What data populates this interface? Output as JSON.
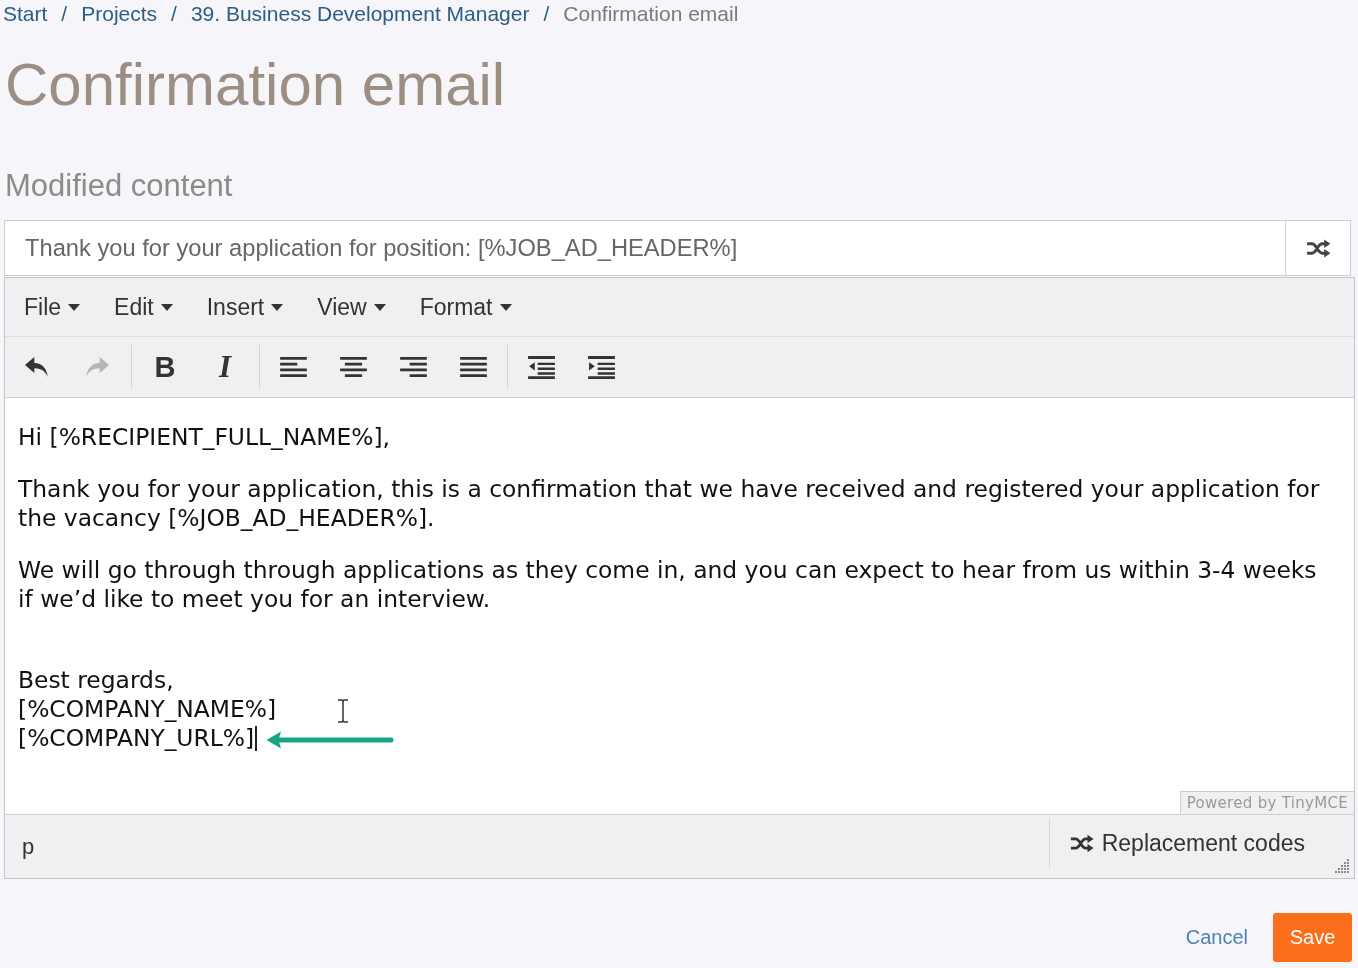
{
  "breadcrumb": [
    {
      "kind": "link",
      "label": "Start"
    },
    {
      "kind": "separator",
      "label": "/"
    },
    {
      "kind": "link",
      "label": "Projects"
    },
    {
      "kind": "separator",
      "label": "/"
    },
    {
      "kind": "link",
      "label": "39. Business Development Manager"
    },
    {
      "kind": "separator",
      "label": "/"
    },
    {
      "kind": "current",
      "label": "Confirmation email"
    }
  ],
  "page_title": "Confirmation email",
  "section_heading": "Modified content",
  "subject_field": {
    "value": "Thank you for your application for position: [%JOB_AD_HEADER%]"
  },
  "editor": {
    "menubar": [
      {
        "label": "File"
      },
      {
        "label": "Edit"
      },
      {
        "label": "Insert"
      },
      {
        "label": "View"
      },
      {
        "label": "Format"
      }
    ],
    "toolbar": [
      {
        "buttons": [
          {
            "kind": "undo",
            "disabled": false
          },
          {
            "kind": "redo",
            "disabled": true
          }
        ]
      },
      {
        "buttons": [
          {
            "kind": "bold",
            "glyph": "B",
            "disabled": false
          },
          {
            "kind": "italic",
            "glyph": "I",
            "disabled": false
          }
        ]
      },
      {
        "buttons": [
          {
            "kind": "align-left",
            "disabled": false
          },
          {
            "kind": "align-center",
            "disabled": false
          },
          {
            "kind": "align-right",
            "disabled": false
          },
          {
            "kind": "justify",
            "disabled": false
          }
        ]
      },
      {
        "buttons": [
          {
            "kind": "outdent",
            "disabled": false
          },
          {
            "kind": "indent",
            "disabled": false
          }
        ]
      }
    ],
    "content": [
      {
        "kind": "paragraph",
        "text": "Hi [%RECIPIENT_FULL_NAME%],"
      },
      {
        "kind": "paragraph",
        "text": "Thank you for your application, this is a confirmation that we have received and registered your application for the vacancy [%JOB_AD_HEADER%]."
      },
      {
        "kind": "paragraph",
        "text": "We will go through through applications as they come in, and you can expect to hear from us within 3-4 weeks if we’d like to meet you for an interview."
      },
      {
        "kind": "signature",
        "lines": [
          {
            "text": "Best regards,",
            "caret": false
          },
          {
            "text": "[%COMPANY_NAME%]",
            "caret": false
          },
          {
            "text": "[%COMPANY_URL%]",
            "caret": true
          }
        ]
      }
    ],
    "branding": "Powered by TinyMCE",
    "status_path": "p",
    "replacement_codes_button": "Replacement codes"
  },
  "actions": [
    {
      "kind": "link",
      "label": "Cancel"
    },
    {
      "kind": "primary",
      "label": "Save"
    }
  ]
}
